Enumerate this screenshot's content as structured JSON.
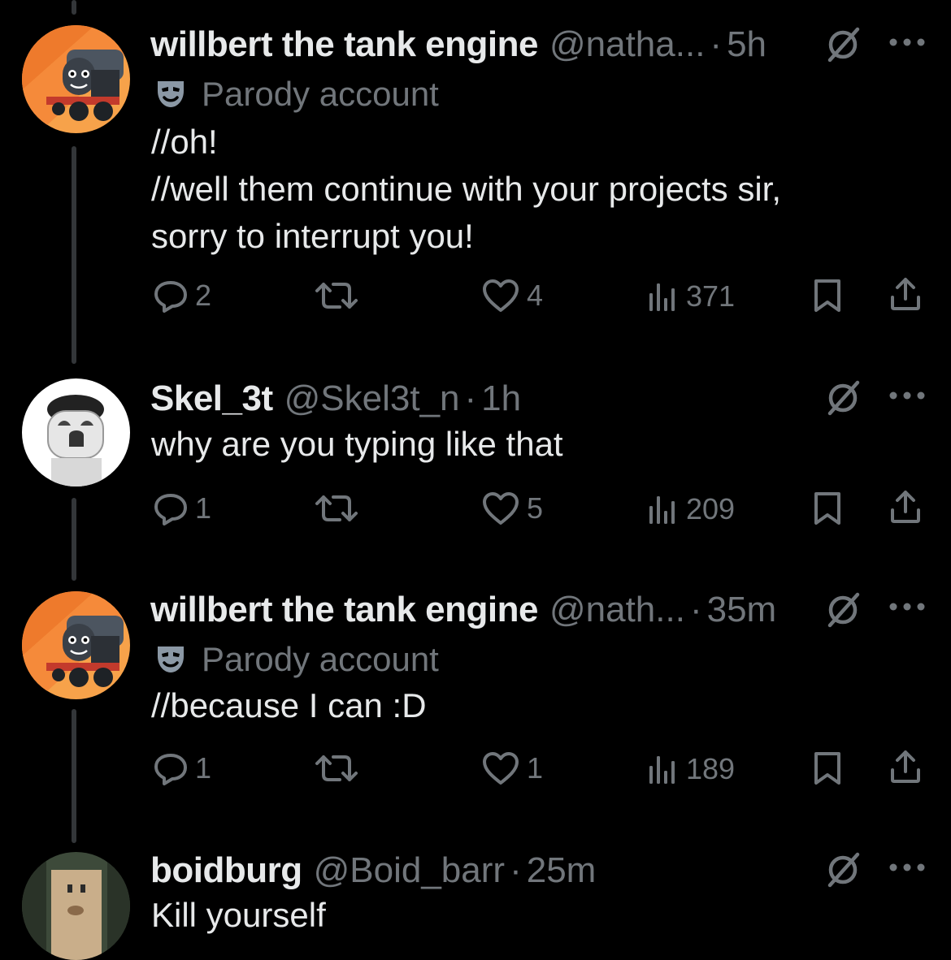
{
  "tweets": [
    {
      "name": "willbert the tank engine",
      "handle": "@natha...",
      "dot": "·",
      "time": "5h",
      "badge": "Parody account",
      "lines": [
        "//oh!",
        "//well them continue with your projects sir,",
        "sorry to interrupt you!"
      ],
      "replies": "2",
      "likes": "4",
      "views": "371",
      "avatar_icon": "train-avatar"
    },
    {
      "name": "Skel_3t",
      "handle": "@Skel3t_n",
      "dot": "·",
      "time": "1h",
      "lines": [
        "why are you typing like that"
      ],
      "replies": "1",
      "likes": "5",
      "views": "209",
      "avatar_icon": "robot-avatar"
    },
    {
      "name": "willbert the tank engine",
      "handle": "@nath...",
      "dot": "·",
      "time": "35m",
      "badge": "Parody account",
      "lines": [
        "//because I can :D"
      ],
      "replies": "1",
      "likes": "1",
      "views": "189",
      "avatar_icon": "train-avatar"
    },
    {
      "name": "boidburg",
      "handle": "@Boid_barr",
      "dot": "·",
      "time": "25m",
      "lines": [
        "Kill yourself"
      ],
      "avatar_icon": "face-avatar"
    }
  ],
  "icons": {
    "grok": "grok-icon",
    "more": "more-icon",
    "reply": "reply-icon",
    "repost": "repost-icon",
    "like": "like-icon",
    "views": "views-icon",
    "bookmark": "bookmark-icon",
    "share": "share-icon",
    "parody": "mask-icon"
  },
  "colors": {
    "background": "#000000",
    "text": "#e7e9ea",
    "muted": "#71767b",
    "thread_line": "#333639"
  }
}
